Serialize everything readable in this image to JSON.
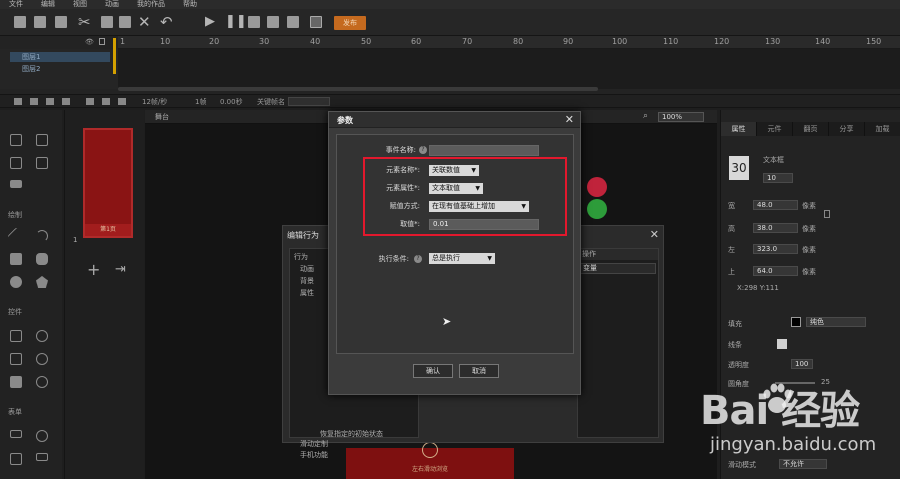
{
  "menu": [
    "文件",
    "编辑",
    "视图",
    "动画",
    "我的作品",
    "帮助"
  ],
  "toolbar": {
    "publish_label": "发布"
  },
  "timeline": {
    "ruler_ticks": [
      "1",
      "10",
      "20",
      "30",
      "40",
      "50",
      "60",
      "70",
      "80",
      "90",
      "100",
      "110",
      "120",
      "130",
      "140",
      "150"
    ],
    "layers": [
      {
        "name": "图层1"
      },
      {
        "name": "图层2"
      }
    ]
  },
  "status_strip": {
    "fps": "12帧/秒",
    "frame": "1帧",
    "time": "0.00秒",
    "keyframe_name": "关键帧名"
  },
  "stage": {
    "label": "舞台",
    "zoom": "100%"
  },
  "tool_sections": {
    "draw": "绘制",
    "controls": "控件",
    "forms": "表单"
  },
  "pages": {
    "thumb_caption": "第1页",
    "page_number": "1"
  },
  "behavior_panel": {
    "title": "编辑行为",
    "tree": [
      "行为",
      "动画",
      "背景",
      "属性",
      "滑动定制",
      "手机功能",
      "恢复指定的初始状态"
    ],
    "right_header": "操作",
    "right_field": "变量"
  },
  "right_panel": {
    "tabs": [
      "属性",
      "元件",
      "翻页",
      "分享",
      "加载"
    ],
    "element_name": "文本框",
    "element_id": "30",
    "element_sub": "10",
    "width_label": "宽",
    "width": "48.0",
    "width_unit": "像素",
    "height_label": "高",
    "height": "38.0",
    "height_unit": "像素",
    "left_label": "左",
    "left": "323.0",
    "left_unit": "像素",
    "top_label": "上",
    "top": "64.0",
    "top_unit": "像素",
    "coords": "X:298  Y:111",
    "fill_label": "填充",
    "fill_value": "纯色",
    "stroke_label": "线条",
    "opacity_label": "透明度",
    "opacity": "100",
    "roundness_label": "圆角度",
    "roundness": "25",
    "scroll_label": "滑动模式",
    "scroll_value": "不允许"
  },
  "dialog": {
    "title": "参数",
    "event_name_label": "事件名称:",
    "event_name_value": "",
    "element_name_label": "元素名称*:",
    "element_name_value": "关联数值",
    "element_attr_label": "元素属性*:",
    "element_attr_value": "文本取值",
    "assign_mode_label": "赋值方式:",
    "assign_mode_value": "在现有值基础上增加",
    "value_label": "取值*:",
    "value_value": "0.01",
    "exec_cond_label": "执行条件:",
    "exec_cond_value": "总是执行",
    "confirm_label": "确认",
    "cancel_label": "取消"
  },
  "poster": {
    "caption": "左右滑动浏览"
  },
  "watermark": {
    "brand": "Bai  经验",
    "url": "jingyan.baidu.com"
  },
  "colors": {
    "highlight_red": "#e3182d",
    "publish_orange": "#c56a1f",
    "playhead": "#d4a000"
  }
}
